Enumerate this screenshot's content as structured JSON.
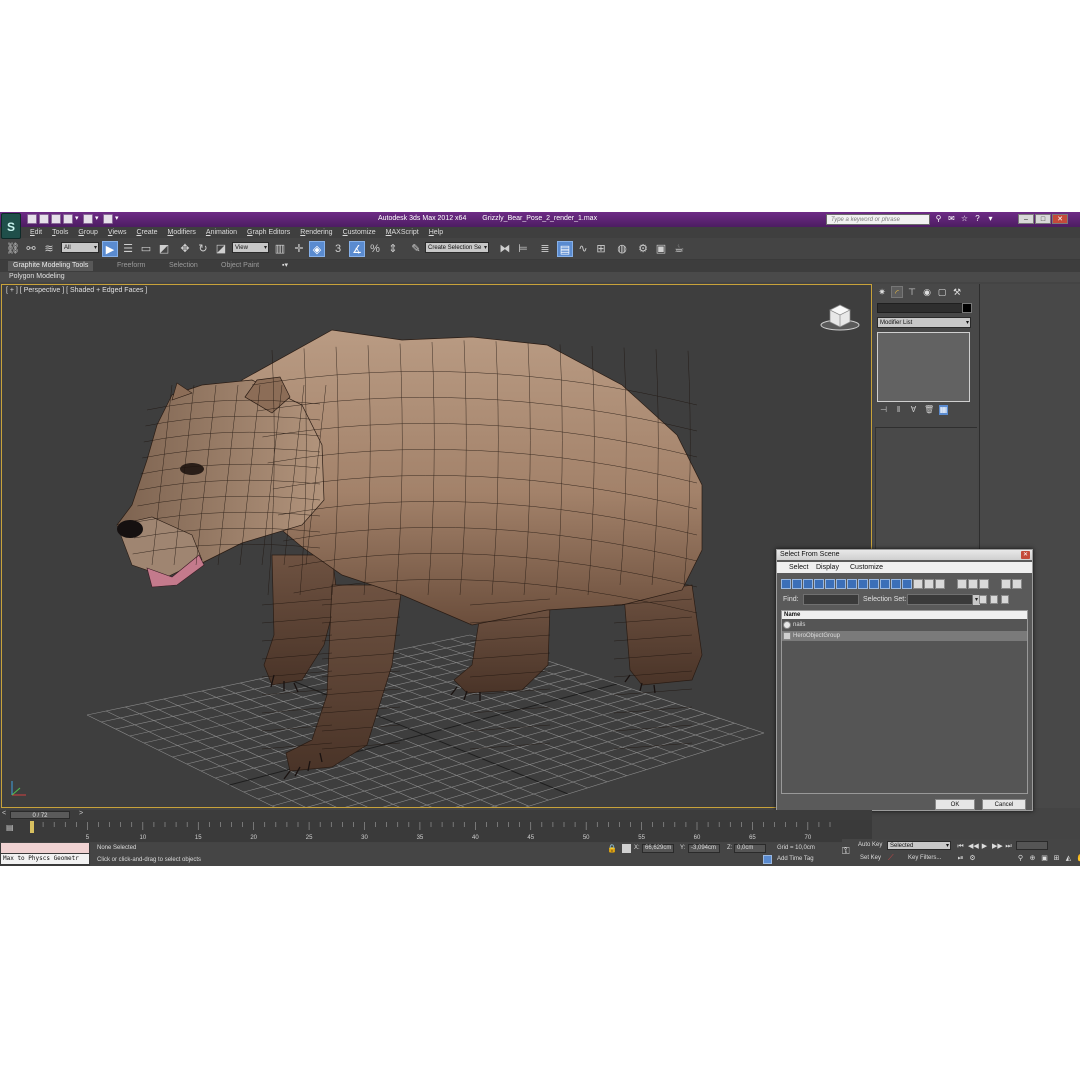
{
  "colors": {
    "titlebar": "#5e2576",
    "viewport_border": "#c8a23a",
    "tool_active": "#5a8bd0",
    "background": "#444444"
  },
  "title": {
    "app": "Autodesk 3ds Max  2012 x64",
    "file": "Grizzly_Bear_Pose_2_render_1.max",
    "search_placeholder": "Type a keyword or phrase"
  },
  "menu": [
    "Edit",
    "Tools",
    "Group",
    "Views",
    "Create",
    "Modifiers",
    "Animation",
    "Graph Editors",
    "Rendering",
    "Customize",
    "MAXScript",
    "Help"
  ],
  "toolbar": {
    "selection_filter": "All",
    "reference_coord": "View",
    "snap_label": "3",
    "selection_set": "Create Selection Se"
  },
  "ribbon": {
    "tabs": [
      "Graphite Modeling Tools",
      "Freeform",
      "Selection",
      "Object Paint"
    ],
    "subtab": "Polygon Modeling"
  },
  "viewport": {
    "label": "[ + ] [ Perspective ] [ Shaded + Edged Faces ]"
  },
  "command_panel": {
    "modifier_list": "Modifier List"
  },
  "dialog": {
    "title": "Select From Scene",
    "menu": [
      "Select",
      "Display",
      "Customize"
    ],
    "find_label": "Find:",
    "selection_set_label": "Selection Set:",
    "column_header": "Name",
    "rows": [
      {
        "name": "nails",
        "selected": false
      },
      {
        "name": "HeroObjectGroup",
        "selected": true
      }
    ],
    "ok": "OK",
    "cancel": "Cancel"
  },
  "timeline": {
    "slider": "0 / 72",
    "start": 0,
    "end": 72,
    "current": 0,
    "tick_labels": [
      "5",
      "10",
      "15",
      "20",
      "25",
      "30",
      "35",
      "40",
      "45",
      "50",
      "55",
      "60",
      "65",
      "70"
    ]
  },
  "status": {
    "script": "Max to Physcs Geometr",
    "selection": "None Selected",
    "prompt": "Click or click-and-drag to select objects",
    "x_label": "X:",
    "x_value": "66,629cm",
    "y_label": "Y:",
    "y_value": "-3,094cm",
    "z_label": "Z:",
    "z_value": "0,0cm",
    "grid": "Grid = 10,0cm",
    "add_time_tag": "Add Time Tag"
  },
  "keys": {
    "auto_key": "Auto Key",
    "set_key": "Set Key",
    "key_mode": "Selected",
    "key_filters": "Key Filters..."
  }
}
